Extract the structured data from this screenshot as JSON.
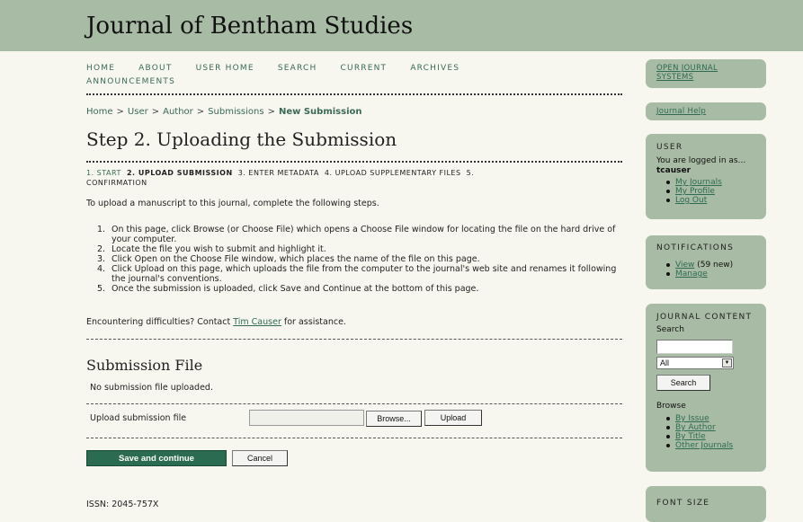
{
  "site": {
    "title": "Journal of Bentham Studies"
  },
  "nav": [
    "HOME",
    "ABOUT",
    "USER HOME",
    "SEARCH",
    "CURRENT",
    "ARCHIVES",
    "ANNOUNCEMENTS"
  ],
  "breadcrumb": {
    "items": [
      "Home",
      "User",
      "Author",
      "Submissions"
    ],
    "separator": ">",
    "current": "New Submission"
  },
  "page": {
    "title": "Step 2. Uploading the Submission",
    "steps": {
      "step1": "1. START",
      "step2": "2. UPLOAD SUBMISSION",
      "step3": "3. ENTER METADATA",
      "step4": "4. UPLOAD SUPPLEMENTARY FILES",
      "step5a": "5.",
      "step5b": "CONFIRMATION"
    },
    "intro": "To upload a manuscript to this journal, complete the following steps.",
    "instructions": [
      {
        "num": "1.",
        "text": "On this page, click Browse (or Choose File) which opens a Choose File window for locating the file on the hard drive of your computer."
      },
      {
        "num": "2.",
        "text": "Locate the file you wish to submit and highlight it."
      },
      {
        "num": "3.",
        "text": "Click Open on the Choose File window, which places the name of the file on this page."
      },
      {
        "num": "4.",
        "text": "Click Upload on this page, which uploads the file from the computer to the journal's web site and renames it following the journal's conventions."
      },
      {
        "num": "5.",
        "text": "Once the submission is uploaded, click Save and Continue at the bottom of this page."
      }
    ],
    "difficulties": {
      "prefix": "Encountering difficulties? Contact",
      "contact": "Tim Causer",
      "suffix": "for assistance."
    },
    "submission_file": {
      "heading": "Submission File",
      "status": "No submission file uploaded.",
      "upload_label": "Upload submission file",
      "browse_label": "Browse...",
      "upload_button": "Upload"
    },
    "save_button": "Save and continue",
    "cancel_button": "Cancel",
    "issn": "ISSN: 2045-757X"
  },
  "sidebar": {
    "ojs_link": "OPEN JOURNAL SYSTEMS",
    "help_link": "Journal Help",
    "user": {
      "heading": "USER",
      "logged_in_text": "You are logged in as...",
      "username": "tcauser",
      "links": [
        "My Journals",
        "My Profile",
        "Log Out"
      ]
    },
    "notifications": {
      "heading": "NOTIFICATIONS",
      "view_label": "View",
      "view_count": "(59 new)",
      "manage_label": "Manage"
    },
    "journal_content": {
      "heading": "JOURNAL CONTENT",
      "search_label": "Search",
      "search_value": "",
      "scope_selected": "All",
      "search_button": "Search",
      "browse_label": "Browse",
      "browse_links": [
        "By Issue",
        "By Author",
        "By Title",
        "Other Journals"
      ]
    },
    "font_size": {
      "heading": "FONT SIZE"
    }
  },
  "colors": {
    "header_bg": "#a8bba4",
    "page_bg": "#f7f7ef",
    "link": "#2e6b52",
    "save_button_bg": "#2a6b51"
  }
}
